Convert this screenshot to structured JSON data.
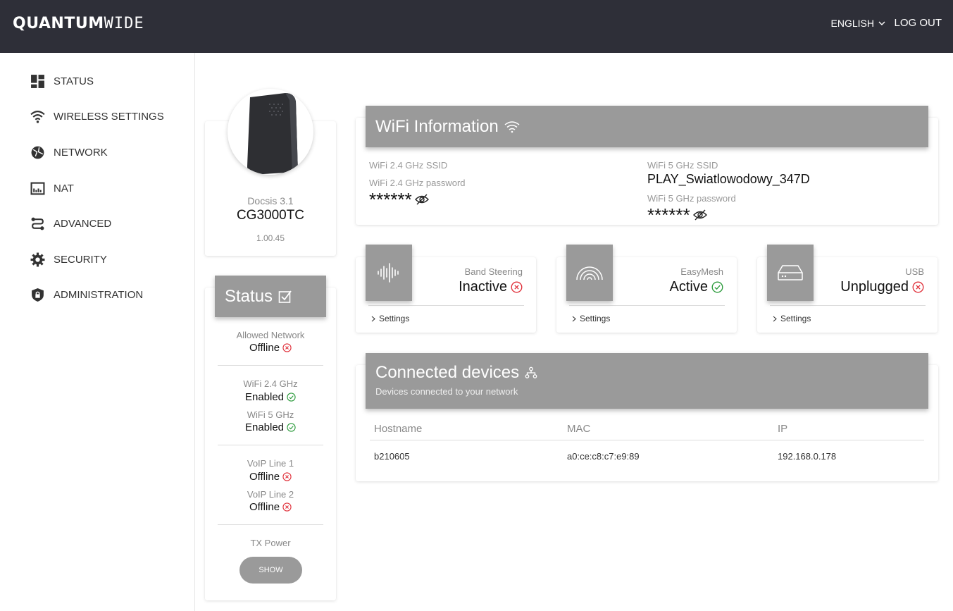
{
  "header": {
    "logo_bold": "QUANTUM",
    "logo_light": "WIDE",
    "language": "ENGLISH",
    "logout": "LOG OUT"
  },
  "sidebar": {
    "items": [
      {
        "label": "STATUS",
        "icon": "dashboard-icon"
      },
      {
        "label": "WIRELESS SETTINGS",
        "icon": "wifi-icon"
      },
      {
        "label": "NETWORK",
        "icon": "globe-icon"
      },
      {
        "label": "NAT",
        "icon": "nat-icon"
      },
      {
        "label": "ADVANCED",
        "icon": "route-icon"
      },
      {
        "label": "SECURITY",
        "icon": "gear-icon"
      },
      {
        "label": "ADMINISTRATION",
        "icon": "shield-icon"
      }
    ]
  },
  "device": {
    "standard": "Docsis 3.1",
    "model": "CG3000TC",
    "version": "1.00.45"
  },
  "status": {
    "title": "Status",
    "allowed_network_label": "Allowed Network",
    "allowed_network_value": "Offline",
    "wifi24_label": "WiFi 2.4 GHz",
    "wifi24_value": "Enabled",
    "wifi5_label": "WiFi 5 GHz",
    "wifi5_value": "Enabled",
    "voip1_label": "VoIP Line 1",
    "voip1_value": "Offline",
    "voip2_label": "VoIP Line 2",
    "voip2_value": "Offline",
    "tx_power_label": "TX Power",
    "show_button": "SHOW"
  },
  "wifi": {
    "title": "WiFi Information",
    "ssid24_label": "WiFi 2.4 GHz SSID",
    "ssid24_value": "",
    "pass24_label": "WiFi 2.4 GHz password",
    "pass24_value": "******",
    "ssid5_label": "WiFi 5 GHz SSID",
    "ssid5_value": "PLAY_Swiatlowodowy_347D",
    "pass5_label": "WiFi 5 GHz password",
    "pass5_value": "******"
  },
  "features": [
    {
      "label": "Band Steering",
      "value": "Inactive",
      "state": "error",
      "settings": "Settings"
    },
    {
      "label": "EasyMesh",
      "value": "Active",
      "state": "ok",
      "settings": "Settings"
    },
    {
      "label": "USB",
      "value": "Unplugged",
      "state": "error",
      "settings": "Settings"
    }
  ],
  "devices": {
    "title": "Connected devices",
    "subtitle": "Devices connected to your network",
    "columns": [
      "Hostname",
      "MAC",
      "IP"
    ],
    "rows": [
      {
        "hostname": "b210605",
        "mac": "a0:ce:c8:c7:e9:89",
        "ip": "192.168.0.178"
      }
    ]
  },
  "colors": {
    "header_bg": "#2e2f38",
    "card_head_bg": "#9a9a9a",
    "error": "#e0303a",
    "ok": "#2a9a3a"
  }
}
